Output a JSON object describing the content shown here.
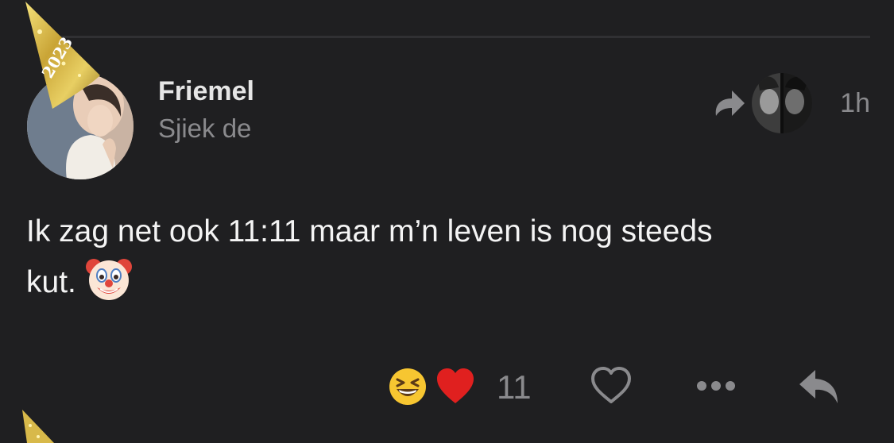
{
  "post": {
    "author_name": "Friemel",
    "author_subtitle": "Sjiek de",
    "timestamp": "1h",
    "body_line1": "Ik zag net ook 11:11 maar m’n leven is nog steeds",
    "body_line2": "kut.",
    "body_emoji": "clown-face",
    "hat_text": "2023"
  },
  "reactions": {
    "emojis": [
      "grinning-squinting-face",
      "red-heart"
    ],
    "count": "11"
  },
  "actions": {
    "like": "heart-outline-icon",
    "more": "ellipsis-icon",
    "reply": "reply-arrow-icon",
    "repost": "repost-arrow-icon"
  },
  "colors": {
    "background": "#1f1f21",
    "primary_text": "#f2f2f2",
    "secondary_text": "#8a8a8d",
    "icon": "#8a8a8d"
  }
}
